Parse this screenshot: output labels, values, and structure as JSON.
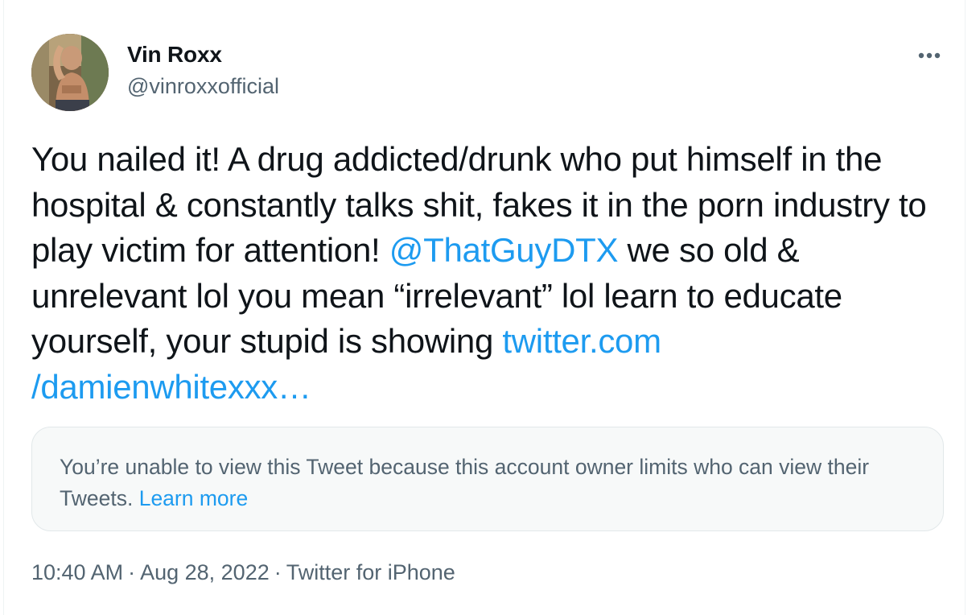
{
  "author": {
    "display_name": "Vin Roxx",
    "handle": "@vinroxxofficial"
  },
  "menu": {
    "more_icon": "more-horizontal-icon"
  },
  "tweet": {
    "text_part1": "You nailed it! A drug addicted/drunk who put himself in the hospital & constantly talks shit, fakes it in the porn industry to play victim for attention! ",
    "mention": "@ThatGuyDTX",
    "text_part2": " we so old & unrelevant lol you mean “irrelevant” lol learn to educate yourself, your stupid is showing ",
    "link_line1": "twitter.com",
    "link_line2": "/damienwhitexxx…"
  },
  "quoted_notice": {
    "text": "You’re unable to view this Tweet because this account owner limits who can view their Tweets.",
    "link": "Learn more"
  },
  "meta": {
    "time": "10:40 AM",
    "date": "Aug 28, 2022",
    "source": "Twitter for iPhone",
    "separator": "·"
  },
  "colors": {
    "text": "#0f1419",
    "secondary": "#536471",
    "link": "#1d9bf0",
    "notice_bg": "#f7f9f9"
  }
}
